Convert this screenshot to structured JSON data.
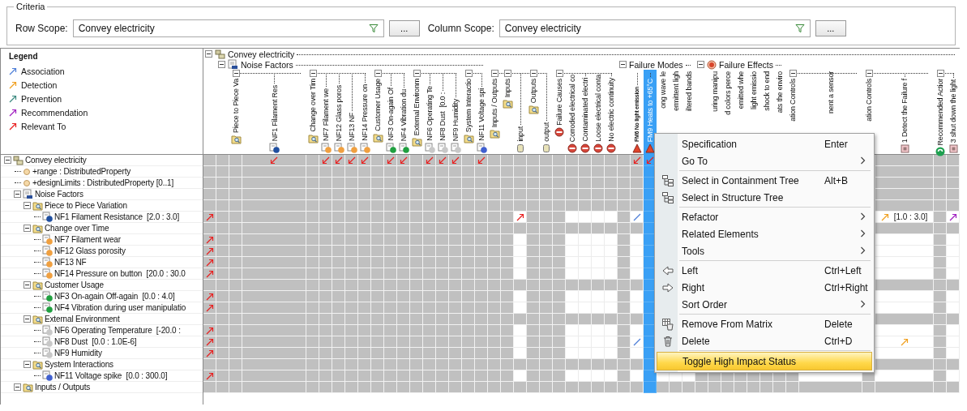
{
  "criteria": {
    "title": "Criteria",
    "row_scope": {
      "label": "Row Scope:",
      "value": "Convey electricity",
      "button": "..."
    },
    "column_scope": {
      "label": "Column Scope:",
      "value": "Convey electricity",
      "button": "..."
    }
  },
  "legend": {
    "title": "Legend",
    "items": [
      {
        "label": "Association",
        "kind": "association",
        "color": "#4f7fd8"
      },
      {
        "label": "Detection",
        "kind": "detection",
        "color": "#f0a020"
      },
      {
        "label": "Prevention",
        "kind": "prevention",
        "color": "#3d8a80"
      },
      {
        "label": "Recommendation",
        "kind": "recommendation",
        "color": "#a020c0"
      },
      {
        "label": "Relevant To",
        "kind": "relevant-to",
        "color": "#e82020"
      }
    ]
  },
  "columns": [
    {
      "label": "Convey electricity",
      "kind": "block",
      "expanded": true,
      "open": false,
      "selected": false,
      "children": [
        {
          "label": "Noise Factors",
          "kind": "factors",
          "expanded": true,
          "open": false,
          "selected": false,
          "children": [
            {
              "label": "Piece to Piece Va",
              "kind": "folder",
              "expanded": true,
              "open": false,
              "selected": false,
              "children": [
                {
                  "label": "NF1 Filament Res",
                  "kind": "factor",
                  "color": "#1f4fa0",
                  "open": false,
                  "selected": false
                }
              ]
            },
            {
              "label": "Change over Tim",
              "kind": "folder",
              "expanded": true,
              "open": false,
              "selected": false,
              "children": [
                {
                  "label": "NF7 Filament we",
                  "kind": "factor",
                  "color": "#f0a040",
                  "open": false,
                  "selected": false
                },
                {
                  "label": "NF12 Glass poros",
                  "kind": "factor",
                  "color": "#f0a040",
                  "open": false,
                  "selected": false
                },
                {
                  "label": "NF13 NF",
                  "kind": "factor",
                  "color": "#f0a040",
                  "open": false,
                  "selected": false
                },
                {
                  "label": "NF14 Pressure on",
                  "kind": "factor",
                  "color": "#f0a040",
                  "open": false,
                  "selected": false
                }
              ]
            },
            {
              "label": "Customer Usage",
              "kind": "folder",
              "expanded": true,
              "open": false,
              "selected": false,
              "children": [
                {
                  "label": "NF3 On-again Of",
                  "kind": "factor",
                  "color": "#20a040",
                  "open": false,
                  "selected": false
                },
                {
                  "label": "NF4 Vibration du",
                  "kind": "factor",
                  "color": "#20a040",
                  "open": false,
                  "selected": false
                }
              ]
            },
            {
              "label": "External Environm",
              "kind": "folder",
              "expanded": true,
              "open": false,
              "selected": false,
              "children": [
                {
                  "label": "NF6 Operating Te",
                  "kind": "factor",
                  "color": "#c8c8c8",
                  "open": false,
                  "selected": false
                },
                {
                  "label": "NF8 Dust  [0.0 :",
                  "kind": "factor",
                  "color": "#c8c8c8",
                  "open": false,
                  "selected": false
                },
                {
                  "label": "NF9 Humidity",
                  "kind": "factor",
                  "color": "#c8c8c8",
                  "open": false,
                  "selected": false
                }
              ]
            },
            {
              "label": "System Interactio",
              "kind": "folder",
              "expanded": true,
              "open": false,
              "selected": false,
              "children": [
                {
                  "label": "NF11 Voltage spi",
                  "kind": "factor",
                  "color": "#4060d0",
                  "open": false,
                  "selected": false
                }
              ]
            }
          ]
        },
        {
          "label": "Inputs / Outputs",
          "kind": "folder",
          "expanded": true,
          "open": false,
          "selected": false,
          "children": [
            {
              "label": "Inputs",
              "kind": "folder",
              "expanded": true,
              "open": false,
              "selected": false,
              "children": [
                {
                  "label": "input",
                  "kind": "port",
                  "open": true,
                  "selected": false
                }
              ]
            },
            {
              "label": "Outputs",
              "kind": "folder",
              "expanded": true,
              "open": false,
              "selected": false,
              "children": [
                {
                  "label": "output",
                  "kind": "port",
                  "open": false,
                  "selected": false
                }
              ]
            }
          ]
        },
        {
          "label": "Failure Causes",
          "kind": "cause",
          "expanded": true,
          "open": false,
          "selected": false,
          "children": [
            {
              "label": "Corroded electrical co",
              "kind": "cause",
              "open": true,
              "selected": false
            },
            {
              "label": "Contaminated electri",
              "kind": "cause",
              "open": true,
              "selected": false
            },
            {
              "label": "Loose electrical conta",
              "kind": "cause",
              "open": true,
              "selected": false
            },
            {
              "label": "No electric continuity",
              "kind": "cause",
              "open": true,
              "selected": false
            }
          ]
        },
        {
          "label": "Failure Modes",
          "kind": "modes",
          "expanded": true,
          "open": false,
          "selected": false,
          "children": [
            {
              "label": "FM6 No light emission",
              "kind": "mode",
              "open": true,
              "selected": false
            },
            {
              "label": "FM9 Heats to +65°C",
              "kind": "mode",
              "open": false,
              "selected": true
            },
            {
              "label": "ong wave le",
              "kind": "mode",
              "open": true,
              "selected": false
            },
            {
              "label": "ermittent ligh",
              "kind": "mode",
              "open": true,
              "selected": false
            },
            {
              "label": "iltered bands",
              "kind": "mode",
              "open": true,
              "selected": false
            }
          ]
        },
        {
          "label": "Failure Effects",
          "kind": "effects",
          "expanded": true,
          "open": false,
          "selected": false,
          "children": [
            {
              "label": "uring manipu",
              "kind": "effect",
              "open": false,
              "selected": false
            },
            {
              "label": "d colors perce",
              "kind": "effect",
              "open": false,
              "selected": false
            },
            {
              "label": "emitted whe",
              "kind": "effect",
              "open": false,
              "selected": false
            },
            {
              "label": "light emissio",
              "kind": "effect",
              "open": false,
              "selected": false
            },
            {
              "label": "shock to end",
              "kind": "effect",
              "open": false,
              "selected": false
            },
            {
              "label": "ats the enviro",
              "kind": "effect",
              "open": false,
              "selected": false
            }
          ]
        },
        {
          "label": "ation Controls",
          "kind": "control",
          "expanded": true,
          "open": false,
          "selected": false,
          "children": [
            {
              "label": "nent a sensor",
              "kind": "requirement",
              "open": true,
              "selected": false
            }
          ]
        },
        {
          "label": "ation Controls",
          "kind": "control",
          "expanded": true,
          "open": false,
          "selected": false,
          "children": [
            {
              "label": "1 Detect the Failure f",
              "kind": "requirement",
              "open": true,
              "selected": false
            }
          ]
        },
        {
          "label": "Recommended Actior",
          "kind": "action",
          "expanded": true,
          "open": false,
          "selected": false,
          "children": [
            {
              "label": "3 shut down the light",
              "kind": "requirement",
              "open": true,
              "selected": false
            }
          ]
        }
      ]
    }
  ],
  "rows": [
    {
      "label": "Convey electricity",
      "kind": "block",
      "expanded": true,
      "open": false,
      "cells": [
        {
          "kind": "none"
        },
        {
          "kind": "none"
        },
        {
          "kind": "none"
        },
        {
          "kind": "relevant-back"
        },
        {
          "kind": "none"
        },
        {
          "kind": "relevant-back"
        },
        {
          "kind": "relevant-back"
        },
        {
          "kind": "relevant-back"
        },
        {
          "kind": "relevant-back"
        },
        {
          "kind": "none"
        },
        {
          "kind": "relevant-back"
        },
        {
          "kind": "relevant-back"
        },
        {
          "kind": "none"
        },
        {
          "kind": "relevant-back"
        },
        {
          "kind": "relevant-back"
        },
        {
          "kind": "relevant-back"
        },
        {
          "kind": "none"
        },
        {
          "kind": "relevant-back"
        },
        {
          "kind": "none"
        },
        {
          "kind": "none"
        },
        {
          "kind": "none"
        },
        {
          "kind": "none"
        },
        {
          "kind": "none"
        },
        {
          "kind": "none"
        },
        {
          "kind": "none"
        },
        {
          "kind": "none"
        },
        {
          "kind": "none"
        },
        {
          "kind": "none"
        },
        {
          "kind": "none"
        },
        {
          "kind": "relevant-back"
        },
        {
          "kind": "relevant-back"
        }
      ],
      "children": [
        {
          "label": "+range : DistributedProperty",
          "kind": "property",
          "open": false
        },
        {
          "label": "+designLimits : DistributedProperty [0..1]",
          "kind": "property",
          "open": false
        },
        {
          "label": "Noise Factors",
          "kind": "factors",
          "expanded": true,
          "open": false,
          "children": [
            {
              "label": "Piece to Piece Variation",
              "kind": "folder",
              "expanded": true,
              "open": false,
              "children": [
                {
                  "label": "NF1 Filament Resistance  [2.0 : 3.0]",
                  "kind": "factor",
                  "color": "#1f4fa0",
                  "open": true,
                  "cells": [
                    {
                      "kind": "relevant-to"
                    },
                    {
                      "kind": "none"
                    },
                    {
                      "kind": "none"
                    },
                    {
                      "kind": "none"
                    },
                    {
                      "kind": "none"
                    },
                    {
                      "kind": "none"
                    },
                    {
                      "kind": "none"
                    },
                    {
                      "kind": "none"
                    },
                    {
                      "kind": "none"
                    },
                    {
                      "kind": "none"
                    },
                    {
                      "kind": "none"
                    },
                    {
                      "kind": "none"
                    },
                    {
                      "kind": "none"
                    },
                    {
                      "kind": "none"
                    },
                    {
                      "kind": "none"
                    },
                    {
                      "kind": "none"
                    },
                    {
                      "kind": "none"
                    },
                    {
                      "kind": "none"
                    },
                    {
                      "kind": "none"
                    },
                    {
                      "kind": "none"
                    },
                    {
                      "kind": "relevant-to"
                    },
                    {
                      "kind": "none"
                    },
                    {
                      "kind": "none"
                    },
                    {
                      "kind": "none"
                    },
                    {
                      "kind": "none"
                    },
                    {
                      "kind": "none"
                    },
                    {
                      "kind": "none"
                    },
                    {
                      "kind": "none"
                    },
                    {
                      "kind": "none"
                    },
                    {
                      "kind": "association"
                    },
                    {
                      "kind": "none"
                    },
                    {
                      "kind": "none"
                    },
                    {
                      "kind": "none"
                    },
                    {
                      "kind": "none"
                    },
                    {
                      "kind": "none"
                    },
                    {
                      "kind": "none"
                    },
                    {
                      "kind": "none"
                    },
                    {
                      "kind": "none"
                    },
                    {
                      "kind": "none"
                    },
                    {
                      "kind": "none"
                    },
                    {
                      "kind": "none"
                    },
                    {
                      "kind": "none"
                    },
                    {
                      "kind": "none"
                    },
                    {
                      "kind": "none"
                    },
                    {
                      "kind": "detection",
                      "text": "[1.0 : 3.0]"
                    },
                    {
                      "kind": "none"
                    },
                    {
                      "kind": "recommendation"
                    }
                  ]
                }
              ]
            },
            {
              "label": "Change over Time",
              "kind": "folder",
              "expanded": true,
              "open": false,
              "children": [
                {
                  "label": "NF7 Filament wear",
                  "kind": "factor",
                  "color": "#f0a040",
                  "open": true,
                  "cells": [
                    {
                      "kind": "relevant-to"
                    }
                  ]
                },
                {
                  "label": "NF12 Glass porosity",
                  "kind": "factor",
                  "color": "#f0a040",
                  "open": true,
                  "cells": [
                    {
                      "kind": "relevant-to"
                    }
                  ]
                },
                {
                  "label": "NF13 NF",
                  "kind": "factor",
                  "color": "#f0a040",
                  "open": true,
                  "cells": [
                    {
                      "kind": "relevant-to"
                    }
                  ]
                },
                {
                  "label": "NF14 Pressure on button  [20.0 : 30.0",
                  "kind": "factor",
                  "color": "#f0a040",
                  "open": true,
                  "cells": [
                    {
                      "kind": "relevant-to"
                    }
                  ]
                }
              ]
            },
            {
              "label": "Customer Usage",
              "kind": "folder",
              "expanded": true,
              "open": false,
              "children": [
                {
                  "label": "NF3 On-again Off-again  [0.0 : 4.0]",
                  "kind": "factor",
                  "color": "#20a040",
                  "open": true,
                  "cells": [
                    {
                      "kind": "relevant-to"
                    }
                  ]
                },
                {
                  "label": "NF4 Vibration during user manipulatio",
                  "kind": "factor",
                  "color": "#20a040",
                  "open": true,
                  "cells": [
                    {
                      "kind": "relevant-to"
                    }
                  ]
                }
              ]
            },
            {
              "label": "External Environment",
              "kind": "folder",
              "expanded": true,
              "open": false,
              "children": [
                {
                  "label": "NF6 Operating Temperature  [-20.0 :",
                  "kind": "factor",
                  "color": "#c8c8c8",
                  "open": true,
                  "cells": [
                    {
                      "kind": "relevant-to"
                    }
                  ]
                },
                {
                  "label": "NF8 Dust  [0.0 : 1.0E-6]",
                  "kind": "factor",
                  "color": "#c8c8c8",
                  "open": true,
                  "cells": [
                    {
                      "kind": "relevant-to"
                    },
                    {
                      "kind": "none"
                    },
                    {
                      "kind": "none"
                    },
                    {
                      "kind": "none"
                    },
                    {
                      "kind": "none"
                    },
                    {
                      "kind": "none"
                    },
                    {
                      "kind": "none"
                    },
                    {
                      "kind": "none"
                    },
                    {
                      "kind": "none"
                    },
                    {
                      "kind": "none"
                    },
                    {
                      "kind": "none"
                    },
                    {
                      "kind": "none"
                    },
                    {
                      "kind": "none"
                    },
                    {
                      "kind": "none"
                    },
                    {
                      "kind": "none"
                    },
                    {
                      "kind": "none"
                    },
                    {
                      "kind": "none"
                    },
                    {
                      "kind": "none"
                    },
                    {
                      "kind": "none"
                    },
                    {
                      "kind": "none"
                    },
                    {
                      "kind": "none"
                    },
                    {
                      "kind": "none"
                    },
                    {
                      "kind": "none"
                    },
                    {
                      "kind": "none"
                    },
                    {
                      "kind": "none"
                    },
                    {
                      "kind": "none"
                    },
                    {
                      "kind": "none"
                    },
                    {
                      "kind": "none"
                    },
                    {
                      "kind": "none"
                    },
                    {
                      "kind": "association"
                    },
                    {
                      "kind": "none"
                    },
                    {
                      "kind": "none"
                    },
                    {
                      "kind": "none"
                    },
                    {
                      "kind": "none"
                    },
                    {
                      "kind": "none"
                    },
                    {
                      "kind": "none"
                    },
                    {
                      "kind": "none"
                    },
                    {
                      "kind": "none"
                    },
                    {
                      "kind": "none"
                    },
                    {
                      "kind": "none"
                    },
                    {
                      "kind": "none"
                    },
                    {
                      "kind": "none"
                    },
                    {
                      "kind": "none"
                    },
                    {
                      "kind": "none"
                    },
                    {
                      "kind": "detection"
                    }
                  ]
                },
                {
                  "label": "NF9 Humidity",
                  "kind": "factor",
                  "color": "#c8c8c8",
                  "open": true,
                  "cells": [
                    {
                      "kind": "relevant-to"
                    }
                  ]
                }
              ]
            },
            {
              "label": "System Interactions",
              "kind": "folder",
              "expanded": true,
              "open": false,
              "children": [
                {
                  "label": "NF11 Voltage spike  [0.0 : 300.0]",
                  "kind": "factor",
                  "color": "#4060d0",
                  "open": true,
                  "cells": [
                    {
                      "kind": "relevant-to"
                    }
                  ]
                }
              ]
            }
          ]
        },
        {
          "label": "Inputs / Outputs",
          "kind": "folder",
          "expanded": true,
          "open": false
        }
      ]
    }
  ],
  "menu": {
    "sections": [
      {
        "items": [
          {
            "label": "Specification",
            "shortcut": "Enter",
            "kind": "plain",
            "submenu": false,
            "selected": false
          },
          {
            "label": "Go To",
            "kind": "plain",
            "submenu": true,
            "selected": false
          }
        ]
      },
      {
        "items": [
          {
            "label": "Select in Containment Tree",
            "shortcut": "Alt+B",
            "kind": "tree",
            "submenu": false,
            "selected": false
          },
          {
            "label": "Select in Structure Tree",
            "kind": "structure",
            "submenu": false,
            "selected": false
          }
        ]
      },
      {
        "items": [
          {
            "label": "Refactor",
            "kind": "plain",
            "submenu": true,
            "selected": false
          },
          {
            "label": "Related Elements",
            "kind": "plain",
            "submenu": true,
            "selected": false
          },
          {
            "label": "Tools",
            "kind": "plain",
            "submenu": true,
            "selected": false
          }
        ]
      },
      {
        "items": [
          {
            "label": "Left",
            "shortcut": "Ctrl+Left",
            "kind": "left",
            "submenu": false,
            "selected": false
          },
          {
            "label": "Right",
            "shortcut": "Ctrl+Right",
            "kind": "right",
            "submenu": false,
            "selected": false
          },
          {
            "label": "Sort Order",
            "kind": "plain",
            "submenu": true,
            "selected": false
          }
        ]
      },
      {
        "items": [
          {
            "label": "Remove From Matrix",
            "shortcut": "Delete",
            "kind": "remove",
            "submenu": false,
            "selected": false
          },
          {
            "label": "Delete",
            "shortcut": "Ctrl+D",
            "kind": "delete",
            "submenu": false,
            "selected": false
          }
        ]
      },
      {
        "items": [
          {
            "label": "Toggle High Impact Status",
            "kind": "plain",
            "submenu": false,
            "selected": true
          }
        ]
      }
    ]
  }
}
